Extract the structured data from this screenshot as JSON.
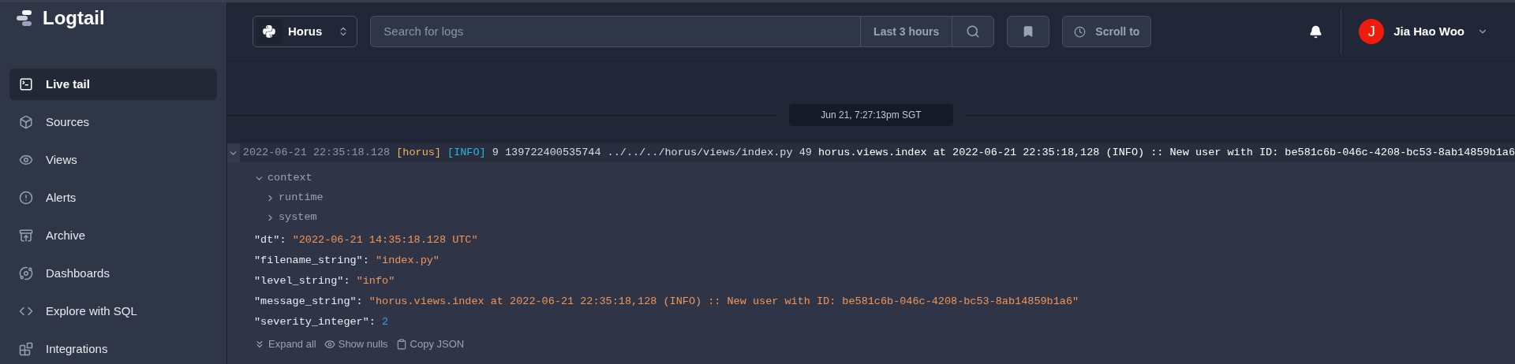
{
  "brand": {
    "name": "Logtail"
  },
  "sidebar": {
    "items": [
      {
        "label": "Live tail",
        "selected": true
      },
      {
        "label": "Sources",
        "selected": false
      },
      {
        "label": "Views",
        "selected": false
      },
      {
        "label": "Alerts",
        "selected": false
      },
      {
        "label": "Archive",
        "selected": false
      },
      {
        "label": "Dashboards",
        "selected": false
      },
      {
        "label": "Explore with SQL",
        "selected": false
      },
      {
        "label": "Integrations",
        "selected": false
      }
    ]
  },
  "header": {
    "source": "Horus",
    "search": {
      "placeholder": "Search for logs"
    },
    "time_range": "Last 3 hours",
    "scroll_to": "Scroll to",
    "user": {
      "initial": "J",
      "name": "Jia Hao Woo"
    }
  },
  "date_separator": "Jun 21, 7:27:13pm SGT",
  "log": {
    "expanded": true,
    "segments": [
      {
        "kind": "timestamp",
        "text": "2022-06-21 22:35:18.128"
      },
      {
        "kind": "source",
        "text": "[horus]"
      },
      {
        "kind": "level",
        "text": "[INFO]"
      },
      {
        "kind": "meta",
        "text": "9 139722400535744 ../../../horus/views/index.py 49"
      },
      {
        "kind": "message",
        "text": "horus.views.index at 2022-06-21 22:35:18,128 (INFO) :: New user with ID: be581c6b-046c-4208-bc53-8ab14859b1a6"
      }
    ],
    "tree": [
      {
        "label": "context",
        "expanded": true,
        "children": [
          {
            "label": "runtime",
            "expanded": false
          },
          {
            "label": "system",
            "expanded": false
          }
        ]
      }
    ],
    "fields": [
      {
        "key": "\"dt\":",
        "kind": "string",
        "value": "\"2022-06-21 14:35:18.128 UTC\""
      },
      {
        "key": "\"filename_string\":",
        "kind": "string",
        "value": "\"index.py\""
      },
      {
        "key": "\"level_string\":",
        "kind": "string",
        "value": "\"info\""
      },
      {
        "key": "\"message_string\":",
        "kind": "string",
        "value": "\"horus.views.index at 2022-06-21 22:35:18,128 (INFO) :: New user with ID: be581c6b-046c-4208-bc53-8ab14859b1a6\""
      },
      {
        "key": "\"severity_integer\":",
        "kind": "number",
        "value": "2"
      }
    ],
    "actions": [
      {
        "label": "Expand all"
      },
      {
        "label": "Show nulls"
      },
      {
        "label": "Copy JSON"
      }
    ]
  }
}
